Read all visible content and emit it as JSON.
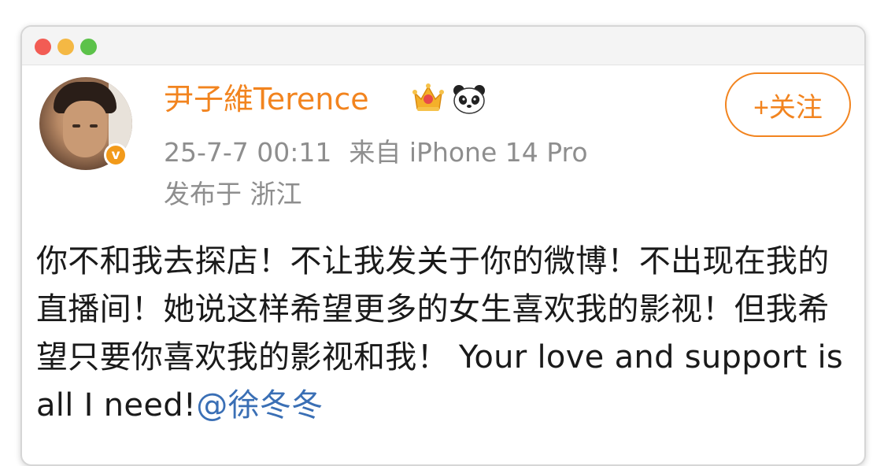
{
  "user": {
    "name": "尹子維Terence",
    "crown_icon": "crown-gem-icon",
    "panda_icon": "panda-icon",
    "verified_badge": "v"
  },
  "meta": {
    "timestamp": "25-7-7 00:11",
    "source": "来自 iPhone 14 Pro",
    "location": "发布于 浙江"
  },
  "follow_button": {
    "label": "+关注"
  },
  "post": {
    "text": "你不和我去探店！不让我发关于你的微博！不出现在我的直播间！她说这样希望更多的女生喜欢我的影视！但我希望只要你喜欢我的影视和我！ Your love and support is all I need!",
    "mention": "@徐冬冬"
  },
  "colors": {
    "accent": "#f2841f",
    "mention": "#3a6fb5",
    "meta_text": "#8e8e8e",
    "body_text": "#1a1a1a"
  }
}
